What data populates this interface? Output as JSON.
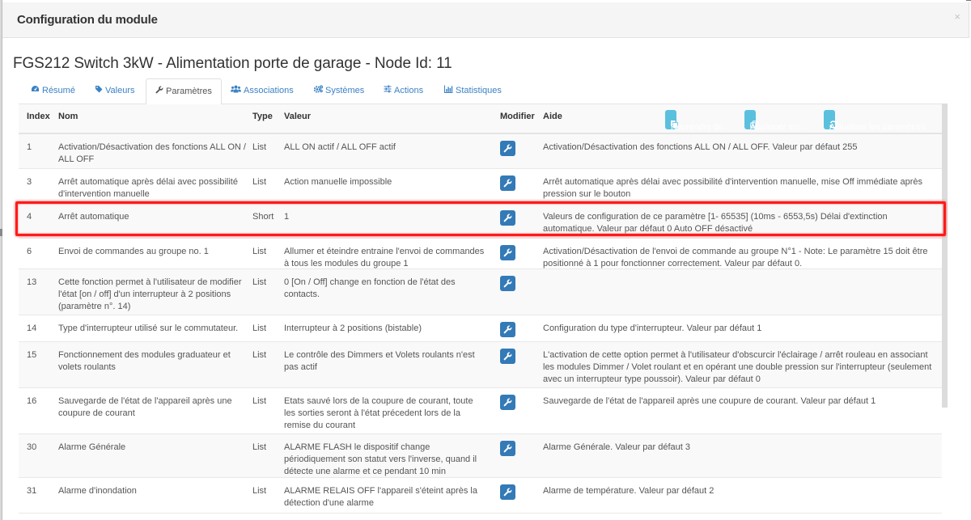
{
  "modal": {
    "title": "Configuration du module",
    "close_glyph": "×"
  },
  "device_title": "FGS212 Switch 3kW - Alimentation porte de garage - Node Id: 11",
  "tabs": [
    {
      "label": "Résumé",
      "icon": "tachometer-icon",
      "glyph": "◕",
      "active": false
    },
    {
      "label": "Valeurs",
      "icon": "tag-icon",
      "glyph": "◆",
      "active": false
    },
    {
      "label": "Paramètres",
      "icon": "wrench-icon",
      "glyph": "🔧",
      "active": true
    },
    {
      "label": "Associations",
      "icon": "users-icon",
      "glyph": "👥",
      "active": false
    },
    {
      "label": "Systèmes",
      "icon": "cogs-icon",
      "glyph": "⚙",
      "active": false
    },
    {
      "label": "Actions",
      "icon": "sliders-icon",
      "glyph": "☰",
      "active": false
    },
    {
      "label": "Statistiques",
      "icon": "bar-chart-icon",
      "glyph": "▥",
      "active": false
    }
  ],
  "table": {
    "headers": {
      "index": "Index",
      "nom": "Nom",
      "type": "Type",
      "valeur": "Valeur",
      "modifier": "Modifier",
      "aide": "Aide"
    },
    "buttons": [
      {
        "label": "Reprendre de...",
        "icon": "copy-icon",
        "glyph": "❐"
      },
      {
        "label": "Appliquer sur...",
        "icon": "clone-icon",
        "glyph": "⧉"
      },
      {
        "label": "Actualiser les paramètres",
        "icon": "refresh-icon",
        "glyph": "⟳"
      }
    ],
    "rows": [
      {
        "index": "1",
        "nom": "Activation/Désactivation des fonctions ALL ON / ALL OFF",
        "type": "List",
        "valeur": "ALL ON actif / ALL OFF actif",
        "aide": "Activation/Désactivation des fonctions ALL ON / ALL OFF. Valeur par défaut 255"
      },
      {
        "index": "3",
        "nom": "Arrêt automatique après délai avec possibilité d'intervention manuelle",
        "type": "List",
        "valeur": "Action manuelle impossible",
        "aide": "Arrêt automatique après délai avec possibilité d'intervention manuelle, mise Off immédiate après pression sur le bouton"
      },
      {
        "index": "4",
        "nom": "Arrêt automatique",
        "type": "Short",
        "valeur": "1",
        "aide": "Valeurs de configuration de ce paramètre [1- 65535] (10ms - 6553,5s) Délai d'extinction automatique. Valeur par défaut 0 Auto OFF désactivé",
        "highlighted": true
      },
      {
        "index": "6",
        "nom": "Envoi de commandes au groupe no. 1",
        "type": "List",
        "valeur": "Allumer et éteindre entraine l'envoi de commandes à tous les modules du groupe 1",
        "aide": "Activation/Désactivation de l'envoi de commande au groupe N°1 - Note: Le paramètre 15 doit être positionné à 1 pour fonctionner correctement. Valeur par défaut 0."
      },
      {
        "index": "13",
        "nom": "Cette fonction permet à l'utilisateur de modifier l'état [on / off] d'un interrupteur à 2 positions (paramètre n°. 14)",
        "type": "List",
        "valeur": "0 [On / Off] change en fonction de l'état des contacts.",
        "aide": ""
      },
      {
        "index": "14",
        "nom": "Type d'interrupteur utilisé sur le commutateur.",
        "type": "List",
        "valeur": "Interrupteur à 2 positions (bistable)",
        "aide": "Configuration du type d'interrupteur. Valeur par défaut 1"
      },
      {
        "index": "15",
        "nom": "Fonctionnement des modules graduateur et volets roulants",
        "type": "List",
        "valeur": "Le contrôle des Dimmers et Volets roulants n'est pas actif",
        "aide": "L'activation de cette option permet à l'utilisateur d'obscurcir l'éclairage / arrêt rouleau en associant les modules Dimmer / Volet roulant et en opérant une double pression sur l'interrupteur (seulement avec un interrupteur type poussoir). Valeur par défaut 0"
      },
      {
        "index": "16",
        "nom": "Sauvegarde de l'état de l'appareil après une coupure de courant",
        "type": "List",
        "valeur": "Etats sauvé lors de la coupure de courant, toute les sorties seront à l'état précedent lors de la remise du courant",
        "aide": "Sauvegarde de l'état de l'appareil après une coupure de courant. Valeur par défaut 1"
      },
      {
        "index": "30",
        "nom": "Alarme Générale",
        "type": "List",
        "valeur": "ALARME FLASH le dispositif change périodiquement son statut vers l'inverse, quand il détecte une alarme et ce pendant 10 min",
        "aide": "Alarme Générale. Valeur par défaut 3"
      },
      {
        "index": "31",
        "nom": "Alarme d'inondation",
        "type": "List",
        "valeur": "ALARME RELAIS OFF l'appareil s'éteint après la détection d'une alarme",
        "aide": "Alarme de température. Valeur par défaut 2"
      }
    ]
  },
  "colors": {
    "link": "#3b82c4",
    "info_button": "#5bc0de",
    "primary_button": "#337ab7",
    "highlight": "#ff1a1a"
  }
}
